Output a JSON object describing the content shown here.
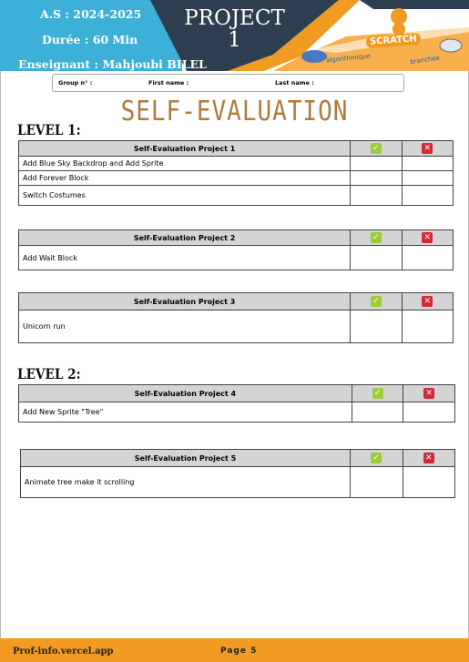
{
  "header": {
    "year_label": "A.S : 2024-2025",
    "duration_label": "Durée :  60 Min",
    "teacher_label": "Enseignant   : Mahjoubi BILEL",
    "project_title_line1": "PROJECT",
    "project_title_line2": "1",
    "logo_text": "SCRATCH",
    "logo_subtitle_left": "algorithmique",
    "logo_subtitle_right": "branchée"
  },
  "form": {
    "group_label": "Group n° :",
    "first_name_label": "First name :",
    "last_name_label": "Last name :"
  },
  "title": "SELF-EVALUATION",
  "levels": [
    {
      "label": "LEVEL 1:"
    },
    {
      "label": "LEVEL 2:"
    }
  ],
  "tables": [
    {
      "header": "Self-Evaluation Project 1",
      "rows": [
        "Add Blue Sky Backdrop and Add Sprite",
        "Add Forever Block",
        "Switch Costumes"
      ]
    },
    {
      "header": "Self-Evaluation Project  2",
      "rows": [
        "Add Wait Block"
      ]
    },
    {
      "header": "Self-Evaluation Project  3",
      "rows": [
        "Unicorn run"
      ]
    },
    {
      "header": "Self-Evaluation Project  4",
      "rows": [
        "Add New Sprite \"Tree\""
      ]
    },
    {
      "header": "Self-Evaluation Project  5",
      "rows": [
        "Animate tree make it scrolling"
      ]
    }
  ],
  "icons": {
    "check": "✓",
    "cross": "✕"
  },
  "colors": {
    "accent_blue": "#3cb0d6",
    "dark_navy": "#2c3e50",
    "orange": "#f29b22",
    "title_brown": "#b07a3a",
    "check_green": "#9ccc3a",
    "cross_red": "#d42a36"
  },
  "footer": {
    "site": "Prof-info.vercel.app",
    "page": "Page 5"
  }
}
